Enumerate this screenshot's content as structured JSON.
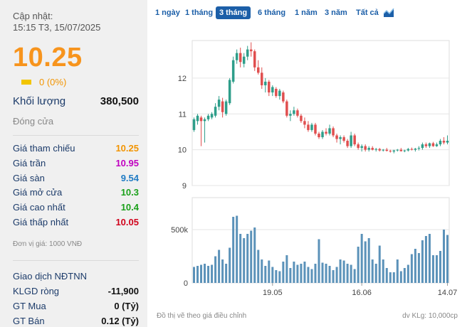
{
  "header": {
    "update_label": "Cập nhật:",
    "update_time": "15:15 T3, 15/07/2025"
  },
  "quote": {
    "price": "10.25",
    "change": "0 (0%)"
  },
  "volume": {
    "label": "Khối lượng",
    "value": "380,500"
  },
  "status": "Đóng cửa",
  "stats": [
    {
      "label": "Giá tham chiếu",
      "value": "10.25",
      "color": "#f29400"
    },
    {
      "label": "Giá trần",
      "value": "10.95",
      "color": "#c000c0"
    },
    {
      "label": "Giá sàn",
      "value": "9.54",
      "color": "#1f7bc4"
    },
    {
      "label": "Giá mở cửa",
      "value": "10.3",
      "color": "#1aa01a"
    },
    {
      "label": "Giá cao nhất",
      "value": "10.4",
      "color": "#1aa01a"
    },
    {
      "label": "Giá thấp nhất",
      "value": "10.05",
      "color": "#d0021b"
    }
  ],
  "unit_note": "Đơn vị giá: 1000 VNĐ",
  "foreign": {
    "title": "Giao dịch NĐTNN",
    "rows": [
      {
        "label": "KLGD ròng",
        "value": "-11,900"
      },
      {
        "label": "GT Mua",
        "value": "0 (Tỷ)"
      },
      {
        "label": "GT Bán",
        "value": "0.12 (Tỷ)"
      }
    ]
  },
  "tabs": [
    "1 ngày",
    "1 tháng",
    "3 tháng",
    "6 tháng",
    "1 năm",
    "3 năm",
    "Tất cả"
  ],
  "active_tab": "3 tháng",
  "chart_icon": "area-chart-icon",
  "footer": {
    "left": "Đồ thị vẽ theo giá điều chỉnh",
    "right": "dv KLg: 10,000cp"
  },
  "chart_data": {
    "type": "candlestick",
    "x_ticks": [
      "19.05",
      "16.06",
      "14.07"
    ],
    "x_tick_index": [
      22,
      47,
      71
    ],
    "price_ticks": [
      9,
      10,
      11,
      12
    ],
    "price_range": [
      9,
      13.05
    ],
    "volume_ticks": [
      "0",
      "500k"
    ],
    "volume_range": [
      0,
      800000
    ],
    "up_color": "#2e9e8a",
    "down_color": "#e04f4f",
    "volume_color": "#5b92b9",
    "candles": [
      [
        10.55,
        10.9,
        10.5,
        10.85
      ],
      [
        10.8,
        11.0,
        10.7,
        10.95
      ],
      [
        10.9,
        10.95,
        10.1,
        10.8
      ],
      [
        10.8,
        10.9,
        10.2,
        10.85
      ],
      [
        10.85,
        11.0,
        10.8,
        10.95
      ],
      [
        10.9,
        11.05,
        10.85,
        11.0
      ],
      [
        10.95,
        11.3,
        10.9,
        11.2
      ],
      [
        11.2,
        11.5,
        11.1,
        11.4
      ],
      [
        11.35,
        11.45,
        10.9,
        11.05
      ],
      [
        11.0,
        11.4,
        10.95,
        11.35
      ],
      [
        11.3,
        12.0,
        11.25,
        11.95
      ],
      [
        11.9,
        12.6,
        11.85,
        12.5
      ],
      [
        12.5,
        12.8,
        12.4,
        12.7
      ],
      [
        12.7,
        12.85,
        12.3,
        12.45
      ],
      [
        12.4,
        12.7,
        12.3,
        12.6
      ],
      [
        12.6,
        12.9,
        12.5,
        12.8
      ],
      [
        12.8,
        13.0,
        12.6,
        12.75
      ],
      [
        12.75,
        12.8,
        12.2,
        12.3
      ],
      [
        12.3,
        12.5,
        12.1,
        12.15
      ],
      [
        12.15,
        12.3,
        11.7,
        11.8
      ],
      [
        11.8,
        12.0,
        11.6,
        11.9
      ],
      [
        11.9,
        11.95,
        11.5,
        11.6
      ],
      [
        11.6,
        11.8,
        11.5,
        11.75
      ],
      [
        11.7,
        11.75,
        11.45,
        11.5
      ],
      [
        11.5,
        11.7,
        11.4,
        11.65
      ],
      [
        11.6,
        11.65,
        11.3,
        11.35
      ],
      [
        11.35,
        11.4,
        10.9,
        10.95
      ],
      [
        10.95,
        11.1,
        10.8,
        11.0
      ],
      [
        11.0,
        11.2,
        10.95,
        11.1
      ],
      [
        11.1,
        11.15,
        10.9,
        10.95
      ],
      [
        10.95,
        11.0,
        10.75,
        10.8
      ],
      [
        10.8,
        10.9,
        10.6,
        10.7
      ],
      [
        10.7,
        10.8,
        10.5,
        10.55
      ],
      [
        10.55,
        10.75,
        10.5,
        10.7
      ],
      [
        10.7,
        10.75,
        10.4,
        10.45
      ],
      [
        10.45,
        10.5,
        10.3,
        10.35
      ],
      [
        10.35,
        10.55,
        10.3,
        10.5
      ],
      [
        10.5,
        10.6,
        10.4,
        10.45
      ],
      [
        10.45,
        10.7,
        10.4,
        10.6
      ],
      [
        10.6,
        10.65,
        10.35,
        10.4
      ],
      [
        10.4,
        10.45,
        10.2,
        10.3
      ],
      [
        10.3,
        10.4,
        10.15,
        10.35
      ],
      [
        10.35,
        10.4,
        10.2,
        10.25
      ],
      [
        10.25,
        10.3,
        10.05,
        10.1
      ],
      [
        10.1,
        10.5,
        10.05,
        10.4
      ],
      [
        10.4,
        10.45,
        10.1,
        10.15
      ],
      [
        10.15,
        10.2,
        10.0,
        10.05
      ],
      [
        10.05,
        10.15,
        9.95,
        10.1
      ],
      [
        10.1,
        10.15,
        9.95,
        10.0
      ],
      [
        10.0,
        10.1,
        9.95,
        10.05
      ],
      [
        10.05,
        10.1,
        9.98,
        10.0
      ],
      [
        10.0,
        10.05,
        9.95,
        10.02
      ],
      [
        10.02,
        10.05,
        9.95,
        9.98
      ],
      [
        9.98,
        10.02,
        9.95,
        10.0
      ],
      [
        10.0,
        10.05,
        9.95,
        9.97
      ],
      [
        9.97,
        10.0,
        9.92,
        9.95
      ],
      [
        9.95,
        10.0,
        9.9,
        9.98
      ],
      [
        9.98,
        10.02,
        9.95,
        10.0
      ],
      [
        10.0,
        10.05,
        9.95,
        9.96
      ],
      [
        9.96,
        10.0,
        9.93,
        9.98
      ],
      [
        9.98,
        10.05,
        9.95,
        10.02
      ],
      [
        10.02,
        10.06,
        9.98,
        10.0
      ],
      [
        10.0,
        10.05,
        9.95,
        10.03
      ],
      [
        10.03,
        10.1,
        9.98,
        10.05
      ],
      [
        10.05,
        10.2,
        10.0,
        10.15
      ],
      [
        10.15,
        10.2,
        10.05,
        10.1
      ],
      [
        10.1,
        10.2,
        10.05,
        10.18
      ],
      [
        10.18,
        10.22,
        10.08,
        10.1
      ],
      [
        10.1,
        10.2,
        10.08,
        10.15
      ],
      [
        10.15,
        10.3,
        10.1,
        10.25
      ],
      [
        10.25,
        10.35,
        10.15,
        10.2
      ],
      [
        10.2,
        10.4,
        10.15,
        10.25
      ]
    ],
    "volumes": [
      150000,
      160000,
      170000,
      180000,
      160000,
      170000,
      250000,
      310000,
      220000,
      180000,
      330000,
      620000,
      630000,
      460000,
      420000,
      460000,
      490000,
      520000,
      310000,
      220000,
      160000,
      210000,
      150000,
      120000,
      110000,
      200000,
      260000,
      140000,
      200000,
      170000,
      180000,
      200000,
      150000,
      130000,
      180000,
      410000,
      190000,
      180000,
      160000,
      120000,
      150000,
      220000,
      210000,
      180000,
      170000,
      130000,
      340000,
      460000,
      390000,
      420000,
      220000,
      180000,
      350000,
      220000,
      140000,
      100000,
      100000,
      220000,
      110000,
      140000,
      170000,
      270000,
      320000,
      280000,
      400000,
      440000,
      460000,
      260000,
      260000,
      300000,
      500000,
      450000
    ]
  }
}
